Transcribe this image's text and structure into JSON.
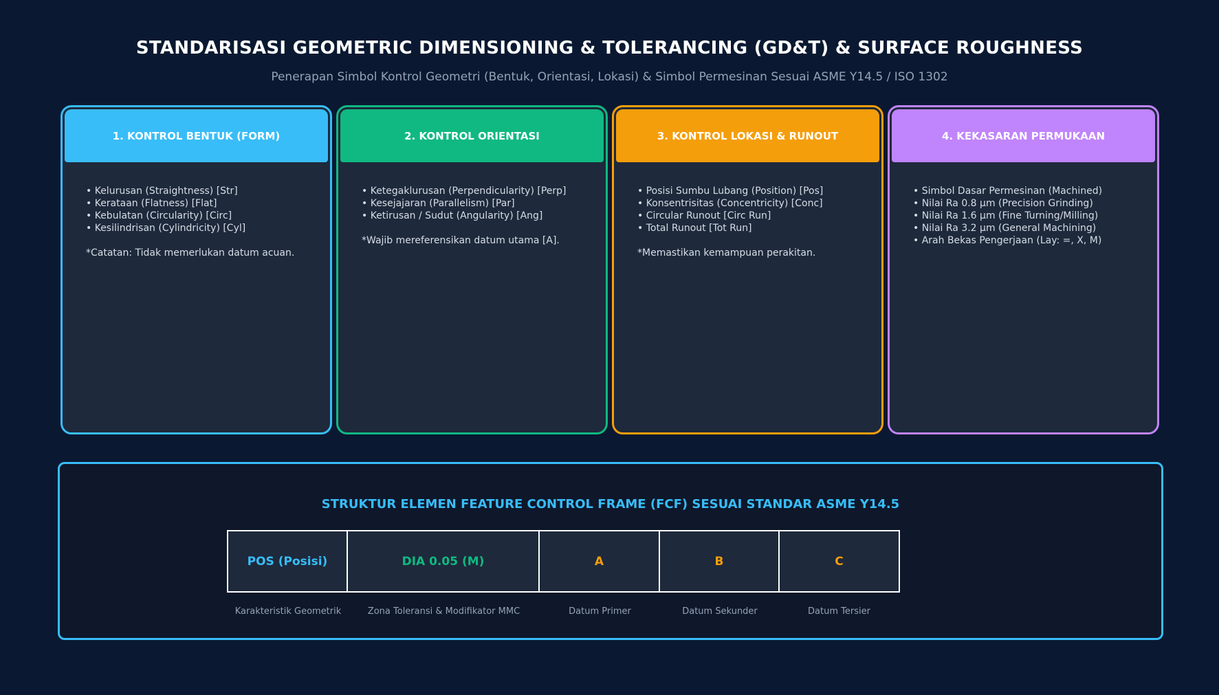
{
  "header": {
    "title": "STANDARISASI GEOMETRIC DIMENSIONING & TOLERANCING (GD&T) & SURFACE ROUGHNESS",
    "subtitle": "Penerapan Simbol Kontrol Geometri (Bentuk, Orientasi, Lokasi) & Simbol Permesinan Sesuai ASME Y14.5 / ISO 1302"
  },
  "cards": [
    {
      "title": "1. KONTROL BENTUK (FORM)",
      "color": "#38bdf8",
      "lines": [
        "• Kelurusan (Straightness) [Str]",
        "• Kerataan (Flatness) [Flat]",
        "• Kebulatan (Circularity) [Circ]",
        "• Kesilindrisan (Cylindricity) [Cyl]",
        "",
        "*Catatan: Tidak memerlukan datum acuan."
      ]
    },
    {
      "title": "2. KONTROL ORIENTASI",
      "color": "#10b981",
      "lines": [
        "• Ketegaklurusan (Perpendicularity) [Perp]",
        "• Kesejajaran (Parallelism) [Par]",
        "• Ketirusan / Sudut (Angularity) [Ang]",
        "",
        "*Wajib mereferensikan datum utama [A]."
      ]
    },
    {
      "title": "3. KONTROL LOKASI & RUNOUT",
      "color": "#f59e0b",
      "lines": [
        "• Posisi Sumbu Lubang (Position) [Pos]",
        "• Konsentrisitas (Concentricity) [Conc]",
        "• Circular Runout [Circ Run]",
        "• Total Runout [Tot Run]",
        "",
        "*Memastikan kemampuan perakitan."
      ]
    },
    {
      "title": "4. KEKASARAN PERMUKAAN",
      "color": "#c084fc",
      "lines": [
        "• Simbol Dasar Permesinan (Machined)",
        "• Nilai Ra 0.8 μm (Precision Grinding)",
        "• Nilai Ra 1.6 μm (Fine Turning/Milling)",
        "• Nilai Ra 3.2 μm (General Machining)",
        "• Arah Bekas Pengerjaan (Lay: =, X, M)"
      ]
    }
  ],
  "fcf": {
    "title": "STRUKTUR ELEMEN FEATURE CONTROL FRAME (FCF) SESUAI STANDAR ASME Y14.5",
    "border_color": "#38bdf8",
    "cells": [
      {
        "value": "POS (Posisi)",
        "label": "Karakteristik Geometrik",
        "color": "#38bdf8"
      },
      {
        "value": "DIA 0.05 (M)",
        "label": "Zona Toleransi & Modifikator MMC",
        "color": "#10b981"
      },
      {
        "value": "A",
        "label": "Datum Primer",
        "color": "#f59e0b"
      },
      {
        "value": "B",
        "label": "Datum Sekunder",
        "color": "#f59e0b"
      },
      {
        "value": "C",
        "label": "Datum Tersier",
        "color": "#f59e0b"
      }
    ]
  }
}
